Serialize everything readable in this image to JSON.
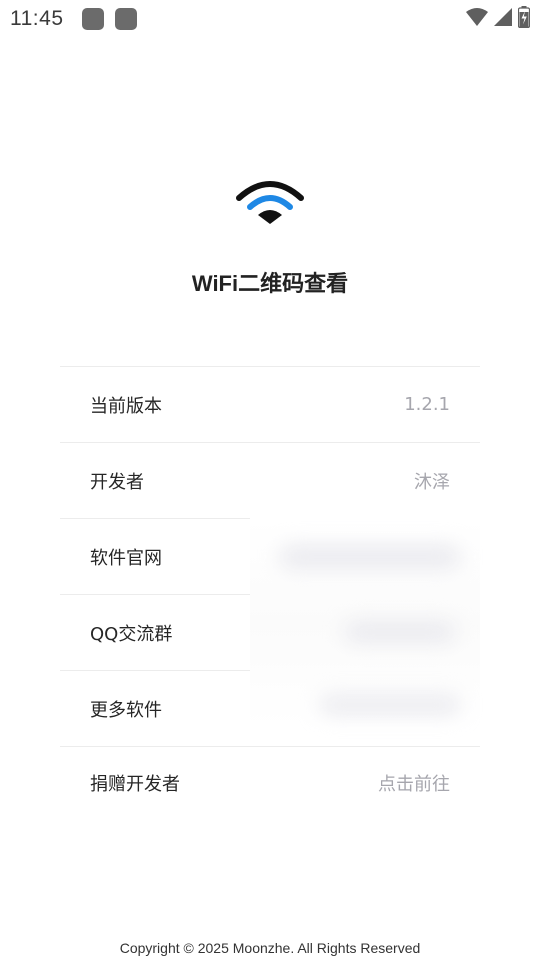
{
  "status_bar": {
    "time": "11:45",
    "icons": [
      "notification-icon",
      "notification-icon",
      "wifi-icon",
      "cell-signal-icon",
      "battery-icon"
    ]
  },
  "app": {
    "title": "WiFi二维码查看",
    "logo_icon": "wifi-logo-icon",
    "accent_color": "#1e88e5"
  },
  "info_list": [
    {
      "label": "当前版本",
      "value": "1.2.1"
    },
    {
      "label": "开发者",
      "value": "沐泽"
    },
    {
      "label": "软件官网",
      "value": ""
    },
    {
      "label": "QQ交流群",
      "value": ""
    },
    {
      "label": "更多软件",
      "value": ""
    },
    {
      "label": "捐赠开发者",
      "value": "点击前往"
    }
  ],
  "footer": {
    "copyright": "Copyright © 2025 Moonzhe. All Rights Reserved"
  }
}
